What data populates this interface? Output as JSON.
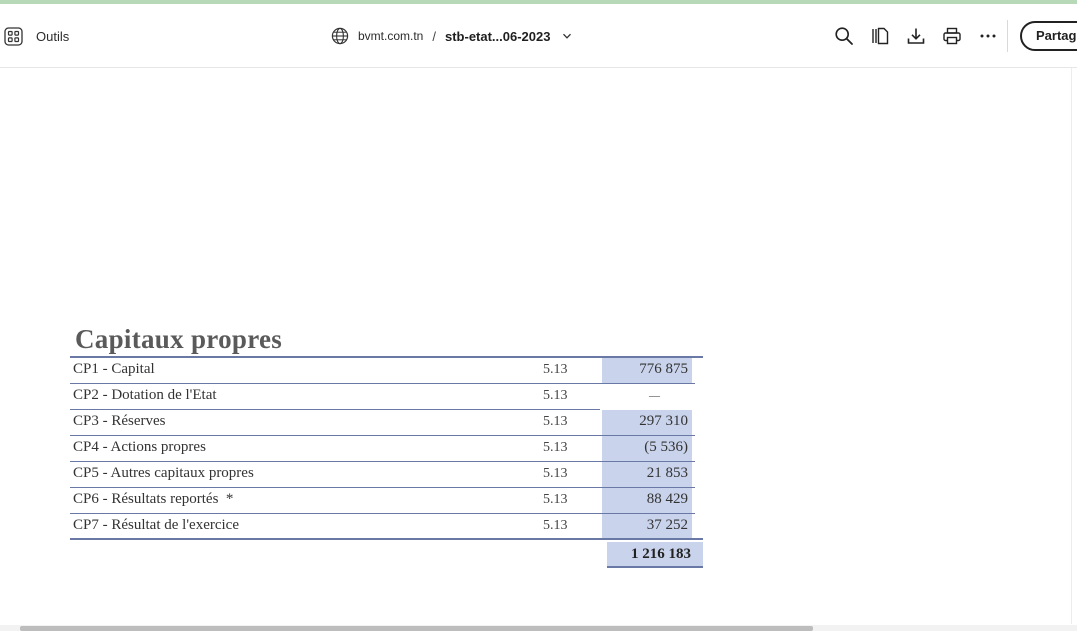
{
  "toolbar": {
    "tools_label": "Outils",
    "domain": "bvmt.com.tn",
    "separator": "/",
    "file_name": "stb-etat...06-2023",
    "share_label": "Partager"
  },
  "icons": {
    "tools": "grid-icon",
    "site": "globe-icon",
    "dropdown": "chevron-down-icon",
    "search": "search-icon",
    "pages": "page-view-icon",
    "download": "download-icon",
    "print": "print-icon",
    "more": "more-icon"
  },
  "document": {
    "heading": "Capitaux propres",
    "rows": [
      {
        "label": "CP1 - Capital",
        "note": "5.13",
        "value": "776 875"
      },
      {
        "label": "CP2 - Dotation de l'Etat",
        "note": "5.13",
        "value": "—"
      },
      {
        "label": "CP3 - Réserves",
        "note": "5.13",
        "value": "297 310"
      },
      {
        "label": "CP4 - Actions propres",
        "note": "5.13",
        "value": "(5 536)"
      },
      {
        "label": "CP5 - Autres capitaux propres",
        "note": "5.13",
        "value": "21 853"
      },
      {
        "label": "CP6 - Résultats reportés  *",
        "note": "5.13",
        "value": "88 429"
      },
      {
        "label": "CP7 - Résultat de l'exercice",
        "note": "5.13",
        "value": "37 252"
      }
    ],
    "total": "1 216 183"
  },
  "colors": {
    "highlight": "#c9d3ec",
    "rule": "#6a78a6",
    "top_accent": "#b7d9b8"
  }
}
